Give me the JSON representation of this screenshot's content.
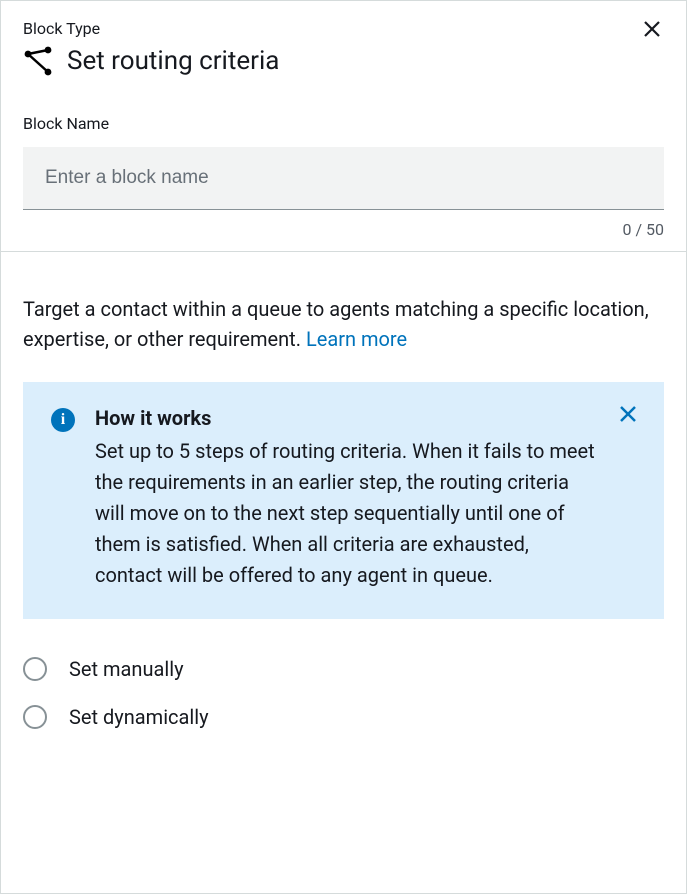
{
  "header": {
    "block_type_label": "Block Type",
    "title": "Set routing criteria"
  },
  "block_name": {
    "label": "Block Name",
    "placeholder": "Enter a block name",
    "value": "",
    "counter": "0 / 50"
  },
  "description": {
    "text": "Target a contact within a queue to agents matching a specific location, expertise, or other requirement. ",
    "learn_more": "Learn more"
  },
  "info_box": {
    "title": "How it works",
    "text": "Set up to 5 steps of routing criteria. When it fails to meet the requirements in an earlier step, the routing criteria will move on to the next step sequentially until one of them is satisfied. When all criteria are exhausted, contact will be offered to any agent in queue."
  },
  "options": {
    "manual": "Set manually",
    "dynamic": "Set dynamically"
  }
}
